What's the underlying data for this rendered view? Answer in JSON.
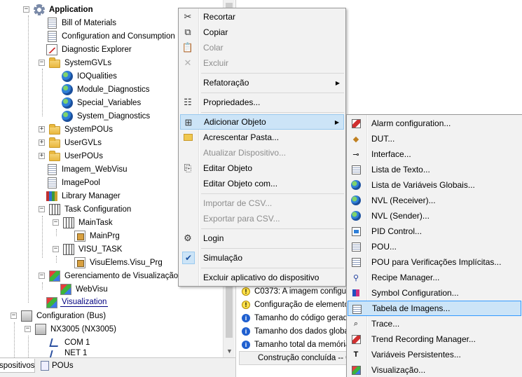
{
  "tree": {
    "items": [
      {
        "label": "Application"
      },
      {
        "label": "Bill of Materials"
      },
      {
        "label": "Configuration and Consumption"
      },
      {
        "label": "Diagnostic Explorer"
      },
      {
        "label": "SystemGVLs"
      },
      {
        "label": "IOQualities"
      },
      {
        "label": "Module_Diagnostics"
      },
      {
        "label": "Special_Variables"
      },
      {
        "label": "System_Diagnostics"
      },
      {
        "label": "SystemPOUs"
      },
      {
        "label": "UserGVLs"
      },
      {
        "label": "UserPOUs"
      },
      {
        "label": "Imagem_WebVisu"
      },
      {
        "label": "ImagePool"
      },
      {
        "label": "Library Manager"
      },
      {
        "label": "Task Configuration"
      },
      {
        "label": "MainTask"
      },
      {
        "label": "MainPrg"
      },
      {
        "label": "VISU_TASK"
      },
      {
        "label": "VisuElems.Visu_Prg"
      },
      {
        "label": "Gerenciamento de Visualização"
      },
      {
        "label": "WebVisu"
      },
      {
        "label": "Visualization"
      },
      {
        "label": "Configuration (Bus)"
      },
      {
        "label": "NX3005 (NX3005)"
      },
      {
        "label": "COM 1"
      },
      {
        "label": "NET 1"
      }
    ]
  },
  "tabs": [
    {
      "label": "spositivos"
    },
    {
      "label": "POUs"
    }
  ],
  "messages": [
    {
      "type": "warning",
      "text": "C0373:  A imagem configu"
    },
    {
      "type": "warning",
      "text": "Configuração de elemento"
    },
    {
      "type": "info",
      "text": "Tamanho do código gerado"
    },
    {
      "type": "info",
      "text": "Tamanho dos dados globai"
    },
    {
      "type": "info",
      "text": "Tamanho total da memória"
    }
  ],
  "status": "Construção concluída -- 0 e",
  "context_menu": {
    "items": [
      {
        "label": "Recortar",
        "icon": "scissors-icon"
      },
      {
        "label": "Copiar",
        "icon": "copy-icon"
      },
      {
        "label": "Colar",
        "icon": "paste-icon"
      },
      {
        "label": "Excluir",
        "icon": "delete-icon"
      },
      {
        "label": "Refatoração"
      },
      {
        "label": "Propriedades...",
        "icon": "properties-icon"
      },
      {
        "label": "Adicionar Objeto",
        "icon": "add-object-icon"
      },
      {
        "label": "Acrescentar Pasta...",
        "icon": "folder-icon"
      },
      {
        "label": "Atualizar Dispositivo..."
      },
      {
        "label": "Editar Objeto",
        "icon": "edit-object-icon"
      },
      {
        "label": "Editar Objeto com..."
      },
      {
        "label": "Importar de CSV..."
      },
      {
        "label": "Exportar para CSV..."
      },
      {
        "label": "Login",
        "icon": "login-icon"
      },
      {
        "label": "Simulação",
        "icon": "checkmark-icon"
      },
      {
        "label": "Excluir aplicativo do dispositivo"
      }
    ]
  },
  "submenu": {
    "items": [
      {
        "label": "Alarm configuration..."
      },
      {
        "label": "DUT..."
      },
      {
        "label": "Interface..."
      },
      {
        "label": "Lista de Texto..."
      },
      {
        "label": "Lista de Variáveis Globais..."
      },
      {
        "label": "NVL (Receiver)..."
      },
      {
        "label": "NVL (Sender)..."
      },
      {
        "label": "PID Control..."
      },
      {
        "label": "POU..."
      },
      {
        "label": "POU para Verificações Implícitas..."
      },
      {
        "label": "Recipe Manager..."
      },
      {
        "label": "Symbol Configuration..."
      },
      {
        "label": "Tabela de Imagens..."
      },
      {
        "label": "Trace..."
      },
      {
        "label": "Trend Recording Manager..."
      },
      {
        "label": "Variáveis Persistentes..."
      },
      {
        "label": "Visualização..."
      }
    ]
  },
  "colors": {
    "menu_highlight": "#cce4f7",
    "menu_highlight_border": "#99c9ef",
    "disabled_text": "#8d8d8d"
  }
}
